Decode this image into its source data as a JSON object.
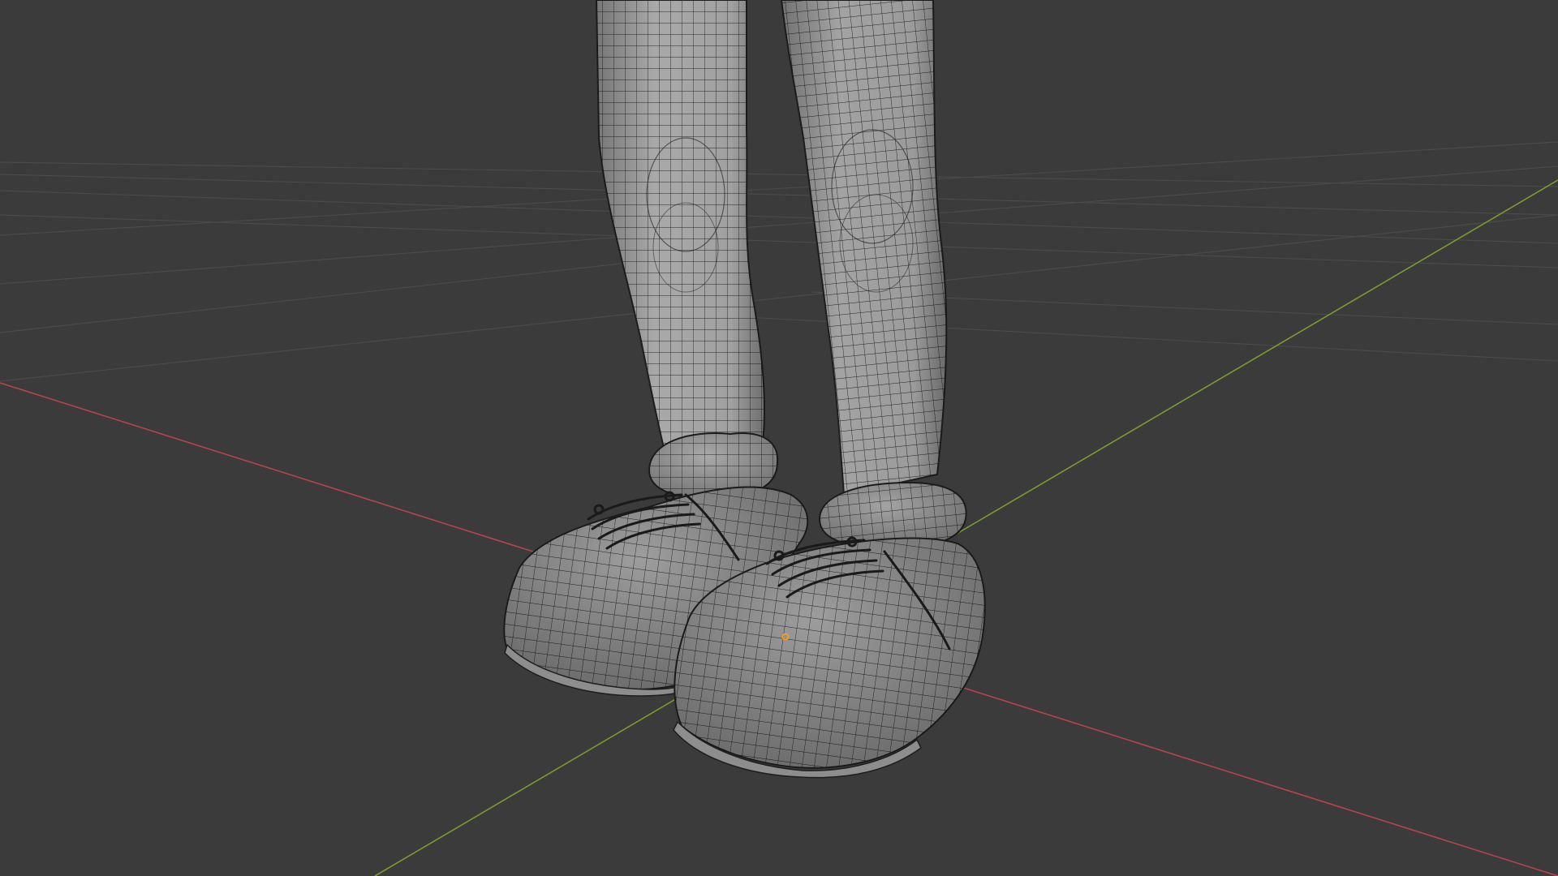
{
  "viewport": {
    "mode": "solid-wireframe",
    "background_color": "#3b3b3b",
    "grid_color": "#4a4a4a",
    "x_axis_color": "#b4444e",
    "y_axis_color": "#7c9a2e",
    "mesh_fill_color": "#a9a9a9",
    "wire_color": "#1e1e1e",
    "origin_color": "#ff9c19"
  },
  "scene": {
    "object": "character-lower-legs-and-shoes",
    "parts": [
      "left-leg",
      "right-leg",
      "left-shoe",
      "right-shoe",
      "left-sock-cuff",
      "right-sock-cuff",
      "left-laces",
      "right-laces"
    ]
  },
  "icons": {
    "origin": "object-origin-icon"
  }
}
